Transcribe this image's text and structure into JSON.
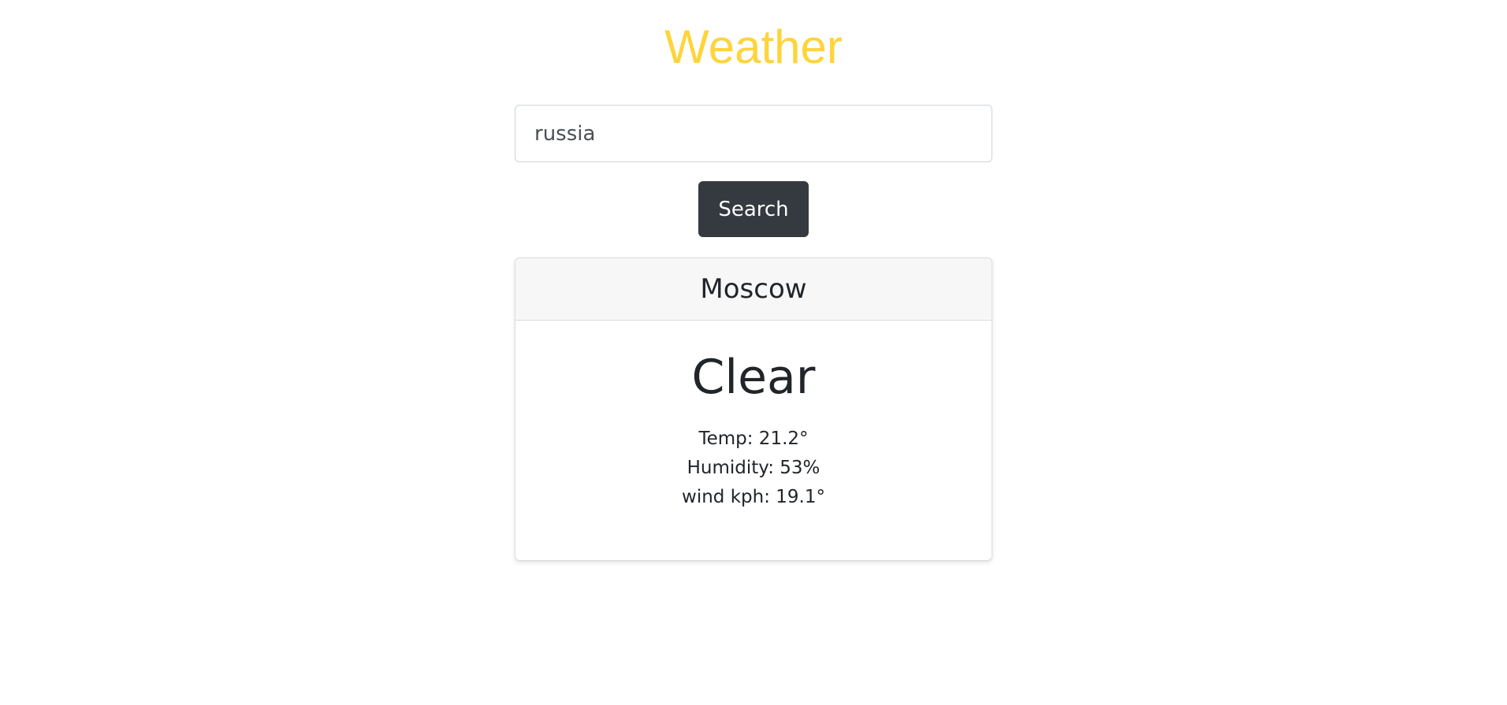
{
  "header": {
    "title": "Weather"
  },
  "search": {
    "value": "russia",
    "button_label": "Search"
  },
  "card": {
    "city": "Moscow",
    "condition": "Clear",
    "temp": "Temp: 21.2°",
    "humidity": "Humidity: 53%",
    "wind": "wind kph: 19.1°"
  },
  "colors": {
    "title": "#ffd43b",
    "button_bg": "#343a40",
    "card_header_bg": "#f7f7f7"
  }
}
